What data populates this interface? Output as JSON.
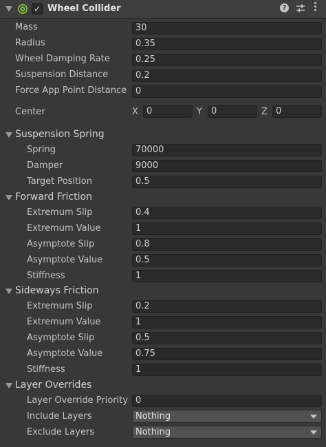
{
  "header": {
    "title": "Wheel Collider",
    "help_glyph": "?",
    "enabled": true
  },
  "props": {
    "mass": {
      "label": "Mass",
      "value": "30"
    },
    "radius": {
      "label": "Radius",
      "value": "0.35"
    },
    "wheel_damping_rate": {
      "label": "Wheel Damping Rate",
      "value": "0.25"
    },
    "suspension_distance": {
      "label": "Suspension Distance",
      "value": "0.2"
    },
    "force_app_point_distance": {
      "label": "Force App Point Distance",
      "value": "0"
    }
  },
  "center": {
    "label": "Center",
    "x_label": "X",
    "x": "0",
    "y_label": "Y",
    "y": "0",
    "z_label": "Z",
    "z": "0"
  },
  "suspension_spring": {
    "title": "Suspension Spring",
    "spring": {
      "label": "Spring",
      "value": "70000"
    },
    "damper": {
      "label": "Damper",
      "value": "9000"
    },
    "target_position": {
      "label": "Target Position",
      "value": "0.5"
    }
  },
  "forward_friction": {
    "title": "Forward Friction",
    "extremum_slip": {
      "label": "Extremum Slip",
      "value": "0.4"
    },
    "extremum_value": {
      "label": "Extremum Value",
      "value": "1"
    },
    "asymptote_slip": {
      "label": "Asymptote Slip",
      "value": "0.8"
    },
    "asymptote_value": {
      "label": "Asymptote Value",
      "value": "0.5"
    },
    "stiffness": {
      "label": "Stiffness",
      "value": "1"
    }
  },
  "sideways_friction": {
    "title": "Sideways Friction",
    "extremum_slip": {
      "label": "Extremum Slip",
      "value": "0.2"
    },
    "extremum_value": {
      "label": "Extremum Value",
      "value": "1"
    },
    "asymptote_slip": {
      "label": "Asymptote Slip",
      "value": "0.5"
    },
    "asymptote_value": {
      "label": "Asymptote Value",
      "value": "0.75"
    },
    "stiffness": {
      "label": "Stiffness",
      "value": "1"
    }
  },
  "layer_overrides": {
    "title": "Layer Overrides",
    "priority": {
      "label": "Layer Override Priority",
      "value": "0"
    },
    "include_layers": {
      "label": "Include Layers",
      "value": "Nothing"
    },
    "exclude_layers": {
      "label": "Exclude Layers",
      "value": "Nothing"
    }
  },
  "icons": {
    "component": "wheel-collider-icon",
    "help": "help-icon",
    "preset": "preset-sliders-icon",
    "menu": "kebab-menu-icon"
  },
  "colors": {
    "background": "#383838",
    "field": "#2a2a2a",
    "accent_green": "#8bc34a"
  }
}
